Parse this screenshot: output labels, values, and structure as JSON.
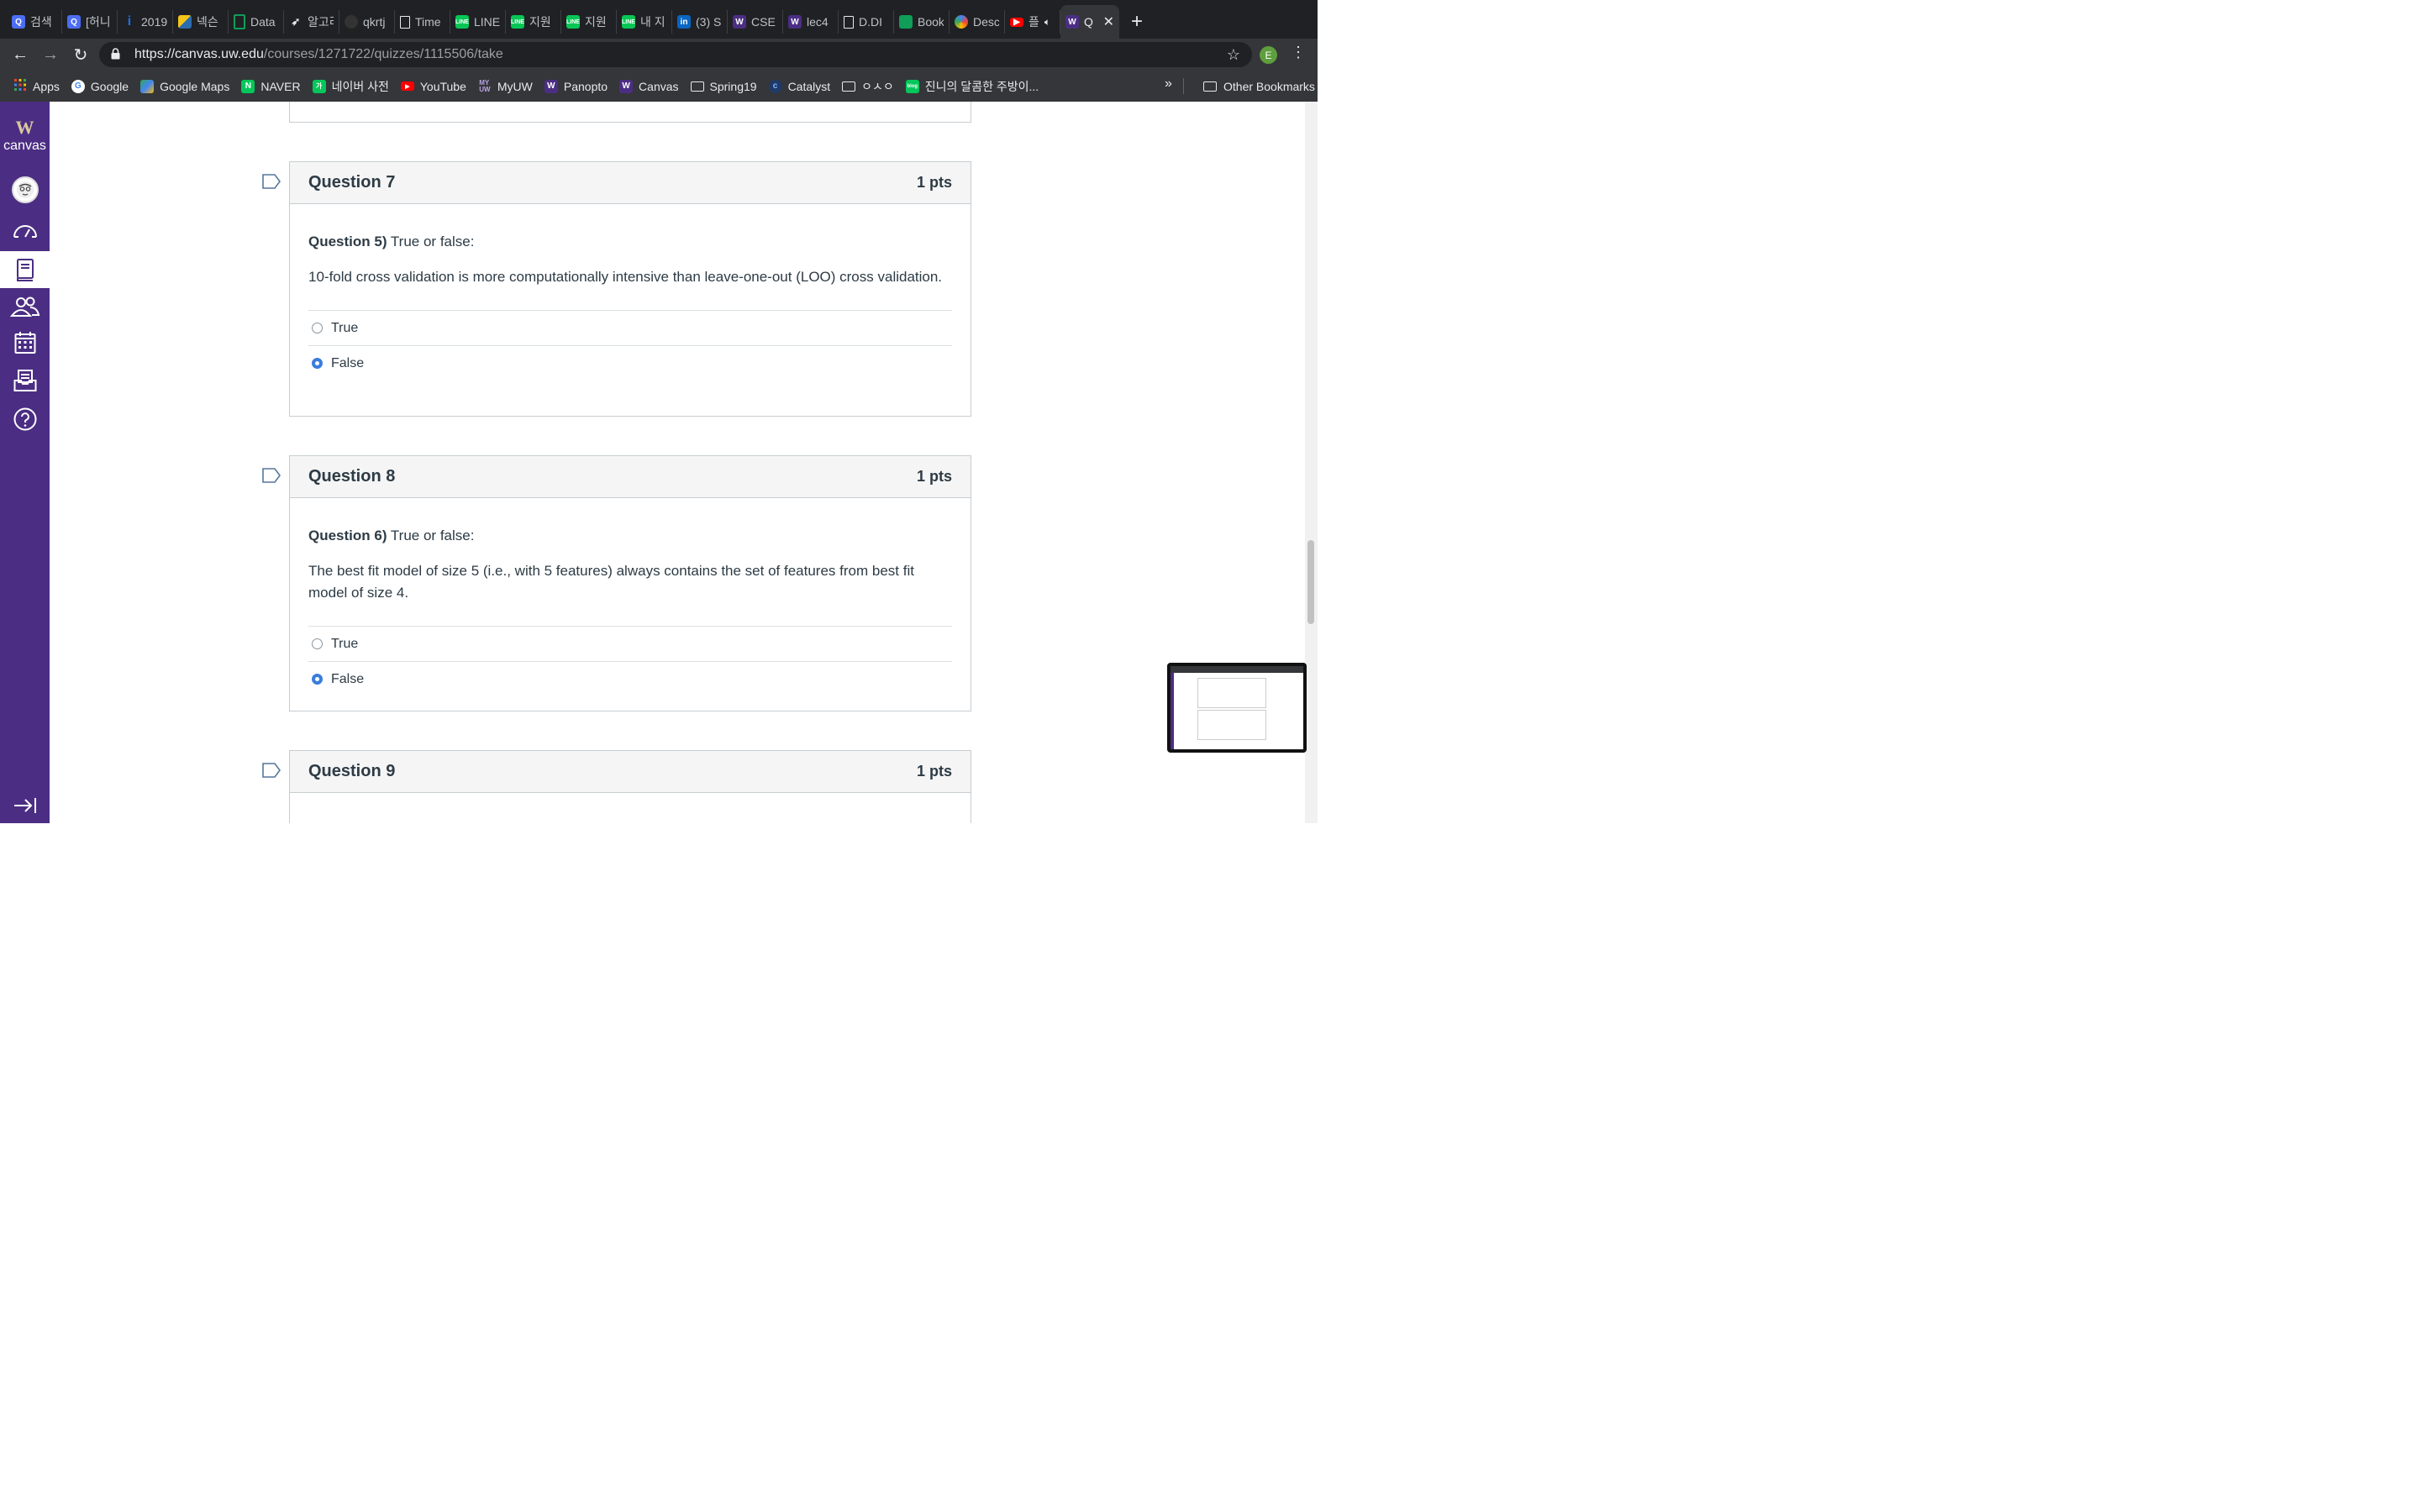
{
  "browser": {
    "tabs": [
      {
        "label": "검색",
        "icon": "search-tab-icon",
        "color": "#4c6ef5"
      },
      {
        "label": "[허니",
        "icon": "search-tab-icon",
        "color": "#4c6ef5"
      },
      {
        "label": "2019",
        "icon": "info-tab-icon",
        "color": "#1a73e8"
      },
      {
        "label": "넥슨",
        "icon": "nexon-tab-icon",
        "color": "#2b6cb0"
      },
      {
        "label": "Data",
        "icon": "sheet-tab-icon",
        "color": "#0f9d58"
      },
      {
        "label": "알고리",
        "icon": "bird-tab-icon",
        "color": "#9aa0a6"
      },
      {
        "label": "qkrtj",
        "icon": "github-tab-icon",
        "color": "#333333"
      },
      {
        "label": "Time",
        "icon": "document-tab-icon",
        "color": "#9aa0a6"
      },
      {
        "label": "LINE",
        "icon": "line-tab-icon",
        "color": "#06c755"
      },
      {
        "label": "지원",
        "icon": "line-tab-icon",
        "color": "#06c755"
      },
      {
        "label": "지원",
        "icon": "line-tab-icon",
        "color": "#06c755"
      },
      {
        "label": "내 지",
        "icon": "line-tab-icon",
        "color": "#06c755"
      },
      {
        "label": "(3) S",
        "icon": "linkedin-tab-icon",
        "color": "#0a66c2"
      },
      {
        "label": "CSE",
        "icon": "uw-tab-icon",
        "color": "#4b2e83"
      },
      {
        "label": "lec4",
        "icon": "uw-tab-icon",
        "color": "#4b2e83"
      },
      {
        "label": "D.DI",
        "icon": "document-tab-icon",
        "color": "#9aa0a6"
      },
      {
        "label": "Book",
        "icon": "sheet-tab-icon",
        "color": "#0f9d58"
      },
      {
        "label": "Desc",
        "icon": "colorful-tab-icon",
        "color": "#4285f4"
      },
      {
        "label": "플",
        "icon": "youtube-tab-icon",
        "color": "#ff0000"
      }
    ],
    "active_tab": {
      "label": "Q",
      "close": "✕"
    },
    "new_tab": "+",
    "url": {
      "host": "https://canvas.uw.edu",
      "path": "/courses/1271722/quizzes/1115506/take"
    },
    "profile_initial": "E",
    "bookmarks": [
      {
        "label": "Apps",
        "icon": "apps-grid-icon",
        "color": "#ea4335"
      },
      {
        "label": "Google",
        "icon": "google-icon",
        "color": "#4285f4"
      },
      {
        "label": "Google Maps",
        "icon": "maps-icon",
        "color": "#34a853"
      },
      {
        "label": "NAVER",
        "icon": "naver-icon",
        "color": "#03c75a"
      },
      {
        "label": "네이버 사전",
        "icon": "naver-dict-icon",
        "color": "#03c75a"
      },
      {
        "label": "YouTube",
        "icon": "youtube-icon",
        "color": "#ff0000"
      },
      {
        "label": "MyUW",
        "icon": "myuw-icon",
        "color": "#4b2e83"
      },
      {
        "label": "Panopto",
        "icon": "uw-icon",
        "color": "#4b2e83"
      },
      {
        "label": "Canvas",
        "icon": "uw-icon",
        "color": "#4b2e83"
      },
      {
        "label": "Spring19",
        "icon": "folder-icon",
        "color": ""
      },
      {
        "label": "Catalyst",
        "icon": "catalyst-icon",
        "color": "#1a73e8"
      },
      {
        "label": "ㅇㅅㅇ",
        "icon": "folder-icon",
        "color": ""
      },
      {
        "label": "진니의 달콤한 주방이...",
        "icon": "blog-icon",
        "color": "#03c75a"
      }
    ],
    "bookmarks_more": "»",
    "other_bookmarks": "Other Bookmarks"
  },
  "canvas_nav": {
    "logo_letter": "W",
    "logo_text": "canvas",
    "items": [
      "account",
      "dashboard",
      "courses",
      "groups",
      "calendar",
      "inbox",
      "help"
    ],
    "active_item": "courses"
  },
  "quiz": {
    "questions": [
      {
        "title": "Question 7",
        "points": "1 pts",
        "prompt_label": "Question 5)",
        "prompt_rest": " True or false:",
        "text": "10-fold cross validation is more computationally intensive than leave-one-out (LOO) cross validation.",
        "answers": [
          "True",
          "False"
        ],
        "selected": "False"
      },
      {
        "title": "Question 8",
        "points": "1 pts",
        "prompt_label": "Question 6)",
        "prompt_rest": " True or false:",
        "text": "The best fit model of size 5 (i.e., with 5 features) always contains the set of features from best fit model of size 4.",
        "answers": [
          "True",
          "False"
        ],
        "selected": "False"
      },
      {
        "title": "Question 9",
        "points": "1 pts"
      }
    ]
  },
  "colors": {
    "canvas_purple": "#4b2e83",
    "radio_selected": "#3b7ddd",
    "header_bg": "#f5f5f5"
  }
}
